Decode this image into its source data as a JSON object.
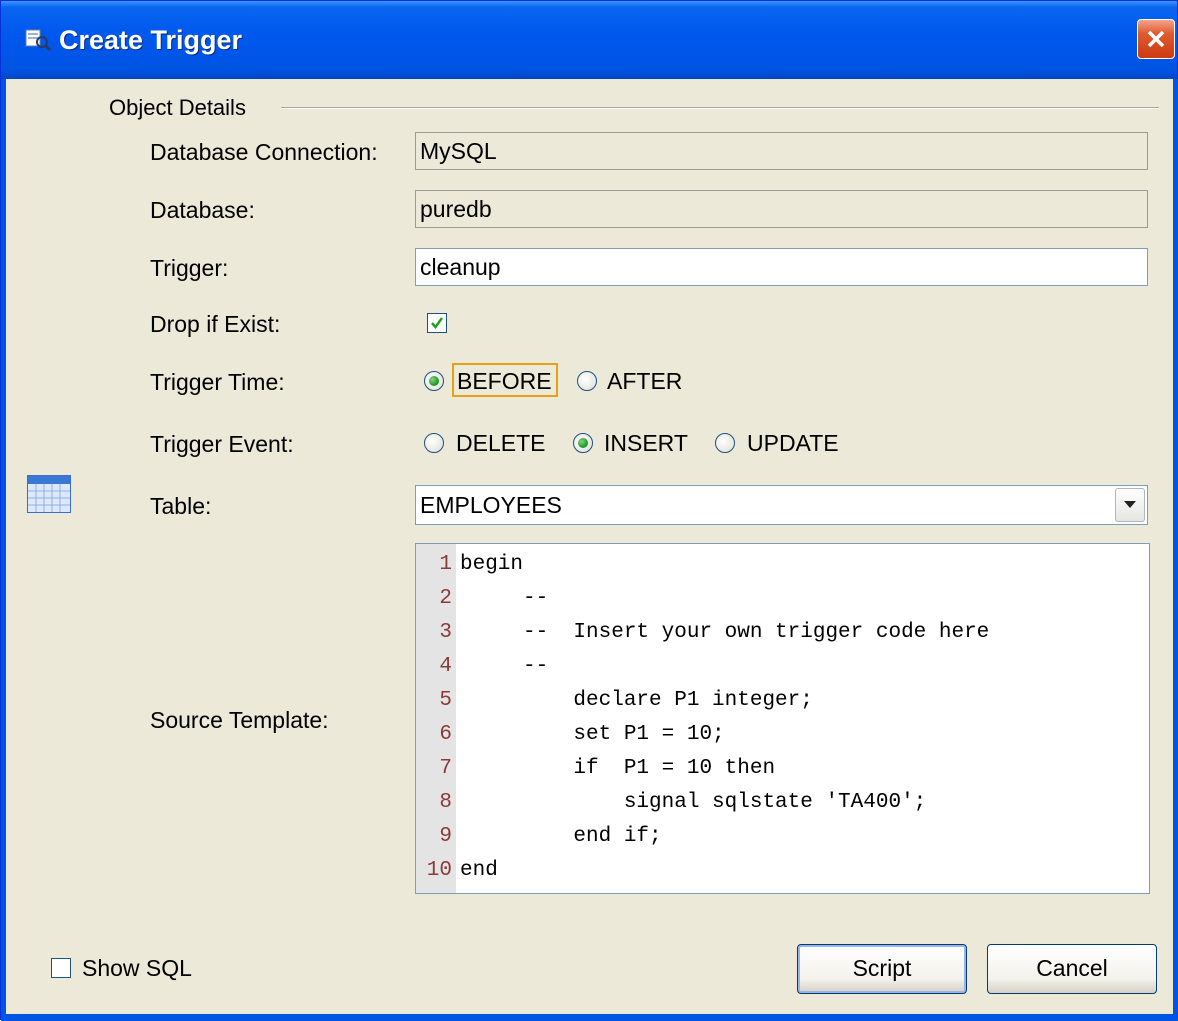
{
  "window": {
    "title": "Create Trigger"
  },
  "section": {
    "title": "Object Details"
  },
  "form": {
    "connection": {
      "label": "Database Connection:",
      "value": "MySQL"
    },
    "database": {
      "label": "Database:",
      "value": "puredb"
    },
    "trigger": {
      "label": "Trigger:",
      "value": "cleanup"
    },
    "drop_if_exist": {
      "label": "Drop if Exist:",
      "checked": true
    },
    "trigger_time": {
      "label": "Trigger Time:",
      "options": [
        "BEFORE",
        "AFTER"
      ],
      "selected": "BEFORE"
    },
    "trigger_event": {
      "label": "Trigger Event:",
      "options": [
        "DELETE",
        "INSERT",
        "UPDATE"
      ],
      "selected": "INSERT"
    },
    "table": {
      "label": "Table:",
      "value": "EMPLOYEES"
    },
    "source": {
      "label": "Source Template:",
      "lines": [
        {
          "n": "1",
          "text": "begin"
        },
        {
          "n": "2",
          "text": "     --"
        },
        {
          "n": "3",
          "text": "     --  Insert your own trigger code here"
        },
        {
          "n": "4",
          "text": "     --"
        },
        {
          "n": "5",
          "text": "         declare P1 integer;"
        },
        {
          "n": "6",
          "text": "         set P1 = 10;"
        },
        {
          "n": "7",
          "text": "         if  P1 = 10 then"
        },
        {
          "n": "8",
          "text": "             signal sqlstate 'TA400';"
        },
        {
          "n": "9",
          "text": "         end if;"
        },
        {
          "n": "10",
          "text": "end"
        }
      ]
    }
  },
  "footer": {
    "show_sql": {
      "label": "Show SQL",
      "checked": false
    },
    "script_label": "Script",
    "cancel_label": "Cancel"
  },
  "colors": {
    "titlebar": "#0054e3",
    "dialog_bg": "#ece9d8",
    "line_number": "#8b3a3a",
    "focus": "#e3a21a"
  }
}
